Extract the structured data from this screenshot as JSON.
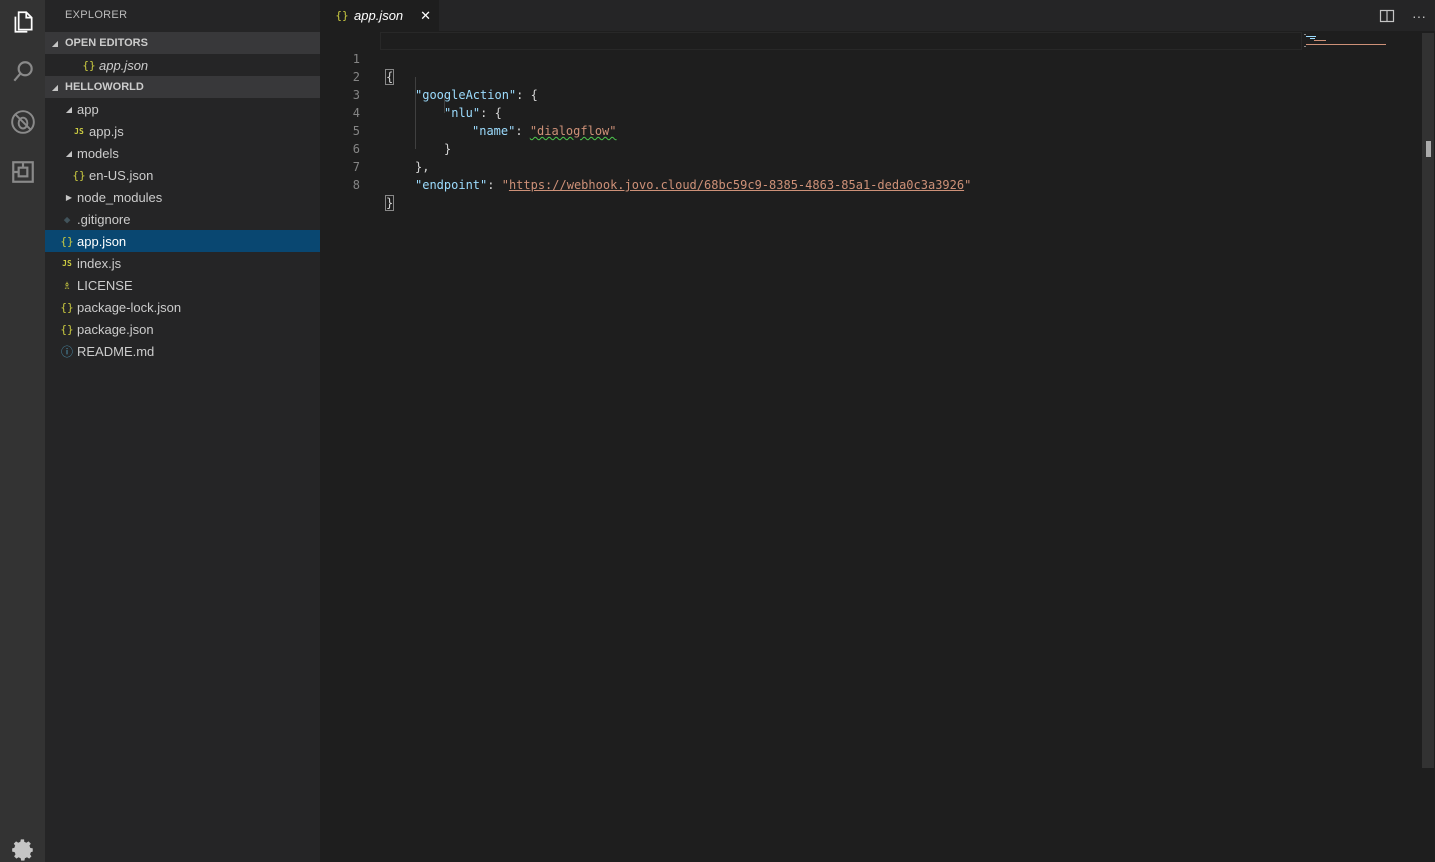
{
  "activity_bar": {
    "items": [
      {
        "icon": "files-icon"
      },
      {
        "icon": "search-icon"
      },
      {
        "icon": "debug-icon"
      },
      {
        "icon": "extensions-icon"
      }
    ],
    "bottom_icon": "gear-icon"
  },
  "sidebar": {
    "title": "EXPLORER",
    "open_editors": {
      "header": "OPEN EDITORS",
      "items": [
        {
          "label": "app.json",
          "icon": "json-icon"
        }
      ]
    },
    "project": {
      "header": "HELLOWORLD",
      "items": [
        {
          "label": "app",
          "type": "folder",
          "expanded": true
        },
        {
          "label": "app.js",
          "type": "file",
          "icon": "js-icon"
        },
        {
          "label": "models",
          "type": "folder",
          "expanded": true
        },
        {
          "label": "en-US.json",
          "type": "file",
          "icon": "json-icon"
        },
        {
          "label": "node_modules",
          "type": "folder",
          "expanded": false
        },
        {
          "label": ".gitignore",
          "type": "file",
          "icon": "git-icon"
        },
        {
          "label": "app.json",
          "type": "file",
          "icon": "json-icon",
          "selected": true
        },
        {
          "label": "index.js",
          "type": "file",
          "icon": "js-icon"
        },
        {
          "label": "LICENSE",
          "type": "file",
          "icon": "license-icon"
        },
        {
          "label": "package-lock.json",
          "type": "file",
          "icon": "json-icon"
        },
        {
          "label": "package.json",
          "type": "file",
          "icon": "json-icon"
        },
        {
          "label": "README.md",
          "type": "file",
          "icon": "info-icon"
        }
      ]
    }
  },
  "editor": {
    "tab": {
      "label": "app.json",
      "close": "✕"
    },
    "actions": {
      "split": "split-editor-icon",
      "more": "···"
    },
    "line_numbers": [
      "1",
      "2",
      "3",
      "4",
      "5",
      "6",
      "7",
      "8"
    ],
    "code": {
      "l1_open": "{",
      "l2_key": "\"googleAction\"",
      "l2_rest": ": {",
      "l3_key": "\"nlu\"",
      "l3_rest": ": {",
      "l4_key": "\"name\"",
      "l4_sep": ": ",
      "l4_val": "\"dialogflow\"",
      "l5": "}",
      "l6": "},",
      "l7_key": "\"endpoint\"",
      "l7_sep": ": ",
      "l7_q1": "\"",
      "l7_url": "https://webhook.jovo.cloud/68bc59c9-8385-4863-85a1-deda0c3a3926",
      "l7_q2": "\"",
      "l8_close": "}"
    }
  }
}
